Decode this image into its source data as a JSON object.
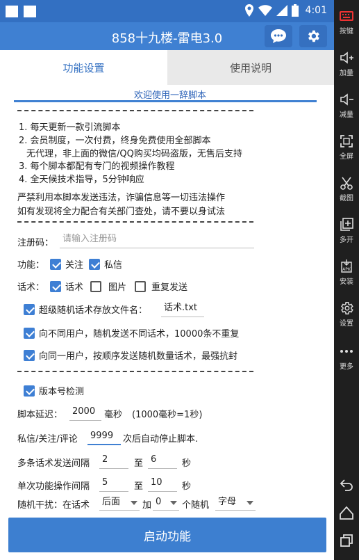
{
  "status": {
    "time": "4:01"
  },
  "app": {
    "title": "858十九楼-雷电3.0"
  },
  "tabs": [
    {
      "label": "功能设置"
    },
    {
      "label": "使用说明"
    }
  ],
  "welcome": "欢迎使用一辞脚本",
  "notice": {
    "items": [
      "1. 每天更新一款引流脚本",
      "2. 会员制度，一次付费，终身免费使用全部脚本",
      "无代理，非上面的微信/QQ购买均码盗版，无售后支持",
      "3. 每个脚本都配有专门的视频操作教程",
      "4. 全天候技术指导，5分钟响应"
    ],
    "warning1": "严禁利用本脚本发送违法，诈骗信息等一切违法操作",
    "warning2": "如有发现将全力配合有关部门查处，请不要以身试法"
  },
  "form": {
    "reg_label": "注册码：",
    "reg_placeholder": "请输入注册码",
    "function_label": "功能：",
    "follow_label": "关注",
    "dm_label": "私信",
    "script_label": "话术：",
    "script_opt": "话术",
    "image_opt": "图片",
    "repeat_opt": "重复发送",
    "super_random_label": "超级随机话术存放文件名：",
    "super_random_value": "话术.txt",
    "diff_user_label": "向不同用户，随机发送不同话术，10000条不重复",
    "same_user_label": "向同一用户，按顺序发送随机数量话术，最强抗封",
    "version_check_label": "版本号检测",
    "delay_label": "脚本延迟：",
    "delay_value": "2000",
    "delay_unit": "毫秒",
    "delay_note": "(1000毫秒=1秒)",
    "stop_label": "私信/关注/评论",
    "stop_value": "9999",
    "stop_suffix": "次后自动停止脚本.",
    "multi_label": "多条话术发送间隔",
    "multi_from": "2",
    "to1": "至",
    "multi_to": "6",
    "sec1": "秒",
    "single_label": "单次功能操作间隔",
    "single_from": "5",
    "to2": "至",
    "single_to": "10",
    "sec2": "秒",
    "interfere_label": "随机干扰：在话术",
    "interfere_pos": "后面",
    "add_label": "加",
    "interfere_count": "0",
    "random_label": "个随机",
    "interfere_type": "字母"
  },
  "start_button": "启动功能",
  "sidebar": [
    {
      "label": "按键",
      "icon": "keyboard-icon"
    },
    {
      "label": "加量",
      "icon": "volume-up-icon"
    },
    {
      "label": "减量",
      "icon": "volume-down-icon"
    },
    {
      "label": "全屏",
      "icon": "fullscreen-icon"
    },
    {
      "label": "截图",
      "icon": "scissors-icon"
    },
    {
      "label": "多开",
      "icon": "multi-open-icon"
    },
    {
      "label": "安装",
      "icon": "apk-install-icon"
    },
    {
      "label": "设置",
      "icon": "gear-icon"
    },
    {
      "label": "更多",
      "icon": "more-icon"
    }
  ],
  "colors": {
    "primary": "#3f80d2",
    "statusbar": "#3370c2",
    "sidebar": "#1f1f1f"
  }
}
